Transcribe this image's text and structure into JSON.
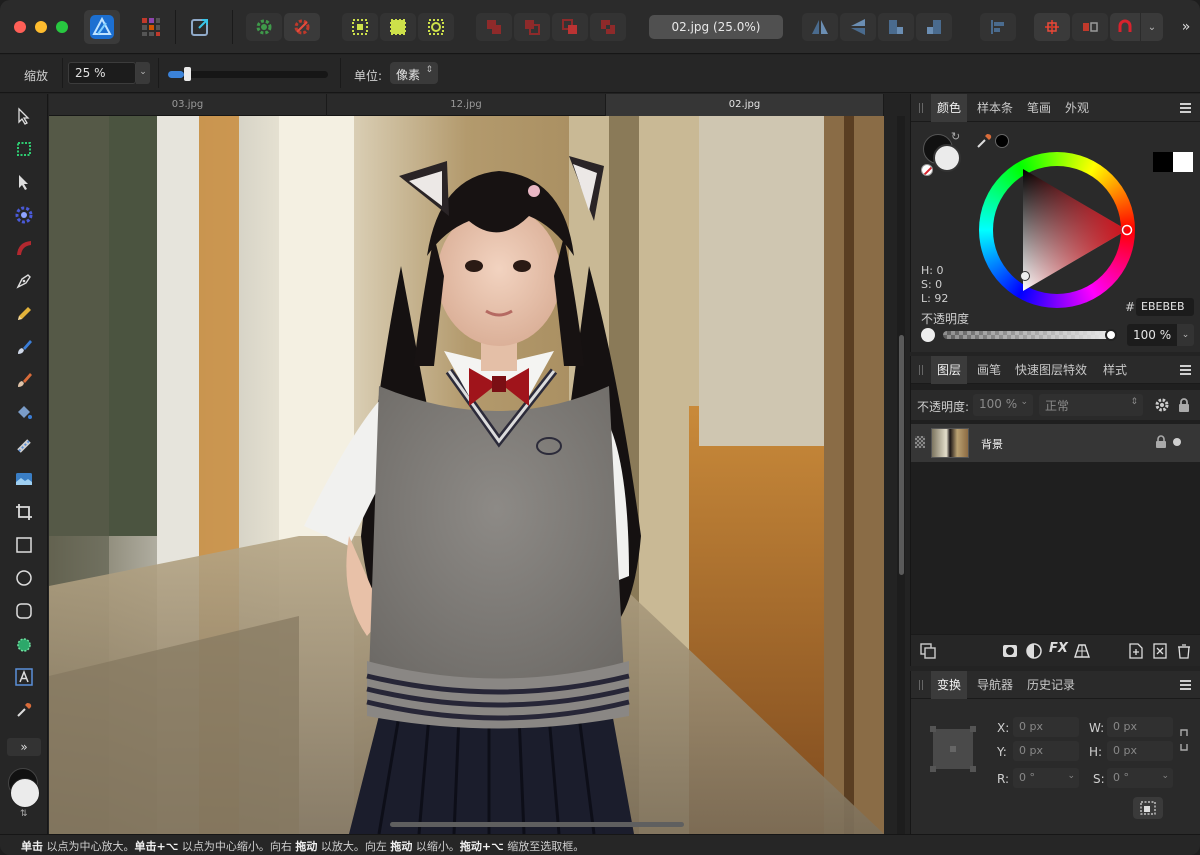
{
  "app": {
    "document_title": "02.jpg (25.0%)"
  },
  "context_bar": {
    "zoom_label": "缩放",
    "zoom_value": "25 %",
    "zoom_level": 0.1,
    "unit_label": "单位:",
    "unit_value": "像素"
  },
  "tabs": [
    {
      "label": "03.jpg",
      "active": false
    },
    {
      "label": "12.jpg",
      "active": false
    },
    {
      "label": "02.jpg",
      "active": true
    }
  ],
  "color_panel": {
    "tabs": [
      "颜色",
      "样本条",
      "笔画",
      "外观"
    ],
    "h": "H: 0",
    "s": "S: 0",
    "l": "L: 92",
    "opacity_label": "不透明度",
    "hex_label": "#:",
    "hex_value": "EBEBEB",
    "opacity_value": "100 %",
    "opacity_level": 1.0,
    "accent": "#c0121c"
  },
  "layers_panel": {
    "tabs": [
      "图层",
      "画笔",
      "快速图层特效",
      "样式"
    ],
    "opacity_label": "不透明度:",
    "opacity_value": "100 %",
    "blend_mode": "正常",
    "layers": [
      {
        "name": "背景"
      }
    ]
  },
  "transform_panel": {
    "tabs": [
      "变换",
      "导航器",
      "历史记录"
    ],
    "x_label": "X:",
    "x_value": "0 px",
    "y_label": "Y:",
    "y_value": "0 px",
    "w_label": "W:",
    "w_value": "0 px",
    "h_label": "H:",
    "h_value": "0 px",
    "r_label": "R:",
    "r_value": "0 °",
    "s_label": "S:",
    "s_value": "0 °"
  },
  "statusbar": {
    "b1": "单击",
    "t1": " 以点为中心放大。",
    "b2": "单击+⌥",
    "t2": " 以点为中心缩小。向右 ",
    "b3": "拖动",
    "t3": " 以放大。向左 ",
    "b4": "拖动",
    "t4": " 以缩小。",
    "b5": "拖动+⌥",
    "t5": " 缩放至选取框。"
  }
}
